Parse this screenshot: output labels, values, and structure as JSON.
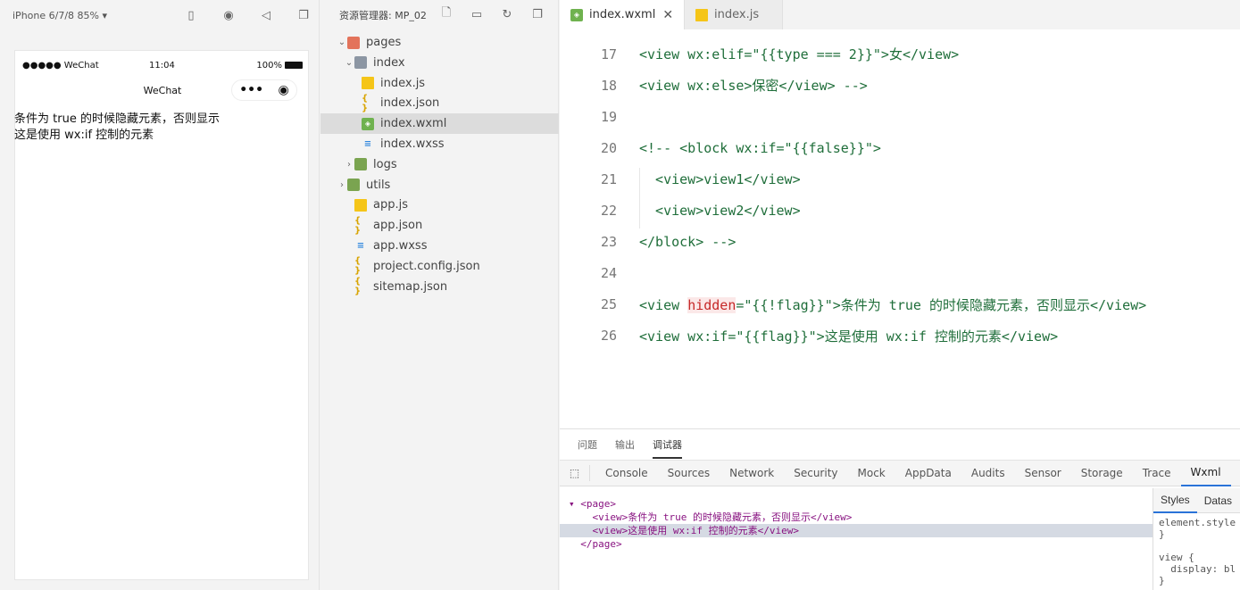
{
  "simulator": {
    "device_label": "iPhone 6/7/8 85% ▾",
    "status_carrier": "●●●●● WeChat",
    "status_time": "11:04",
    "status_battery": "100%",
    "nav_title": "WeChat",
    "capsule_more": "•••",
    "capsule_close": "◉",
    "content_lines": [
      "条件为 true 的时候隐藏元素，否则显示",
      "这是使用 wx:if 控制的元素"
    ]
  },
  "explorer": {
    "title": "资源管理器: MP_02",
    "tree": [
      {
        "label": "pages",
        "icon": "folder-red",
        "chev": "⌄",
        "indent": 0
      },
      {
        "label": "index",
        "icon": "folder-gray",
        "chev": "⌄",
        "indent": 1
      },
      {
        "label": "index.js",
        "icon": "js",
        "chev": "",
        "indent": 2
      },
      {
        "label": "index.json",
        "icon": "json",
        "chev": "",
        "indent": 2
      },
      {
        "label": "index.wxml",
        "icon": "wxml",
        "chev": "",
        "indent": 2,
        "selected": true
      },
      {
        "label": "index.wxss",
        "icon": "wxss",
        "chev": "",
        "indent": 2
      },
      {
        "label": "logs",
        "icon": "folder-green",
        "chev": "›",
        "indent": 1
      },
      {
        "label": "utils",
        "icon": "folder-green",
        "chev": "›",
        "indent": 0
      },
      {
        "label": "app.js",
        "icon": "js",
        "chev": "",
        "indent": 1
      },
      {
        "label": "app.json",
        "icon": "json",
        "chev": "",
        "indent": 1
      },
      {
        "label": "app.wxss",
        "icon": "wxss",
        "chev": "",
        "indent": 1
      },
      {
        "label": "project.config.json",
        "icon": "json",
        "chev": "",
        "indent": 1
      },
      {
        "label": "sitemap.json",
        "icon": "json",
        "chev": "",
        "indent": 1
      }
    ]
  },
  "editor": {
    "tabs": [
      {
        "label": "index.wxml",
        "active": true,
        "close": "✕"
      },
      {
        "label": "index.js",
        "active": false
      }
    ],
    "lines": [
      {
        "num": "17",
        "text": "<view wx:elif=\"{{type === 2}}\">女</view>"
      },
      {
        "num": "18",
        "text": "<view wx:else>保密</view> -->"
      },
      {
        "num": "19",
        "text": ""
      },
      {
        "num": "20",
        "text": "<!-- <block wx:if=\"{{false}}\">"
      },
      {
        "num": "21",
        "text": "  <view>view1</view>"
      },
      {
        "num": "22",
        "text": "  <view>view2</view>"
      },
      {
        "num": "23",
        "text": "</block> -->"
      },
      {
        "num": "24",
        "text": ""
      },
      {
        "num": "25",
        "pre": "<view ",
        "hl": "hidden",
        "post": "=\"{{!flag}}\">条件为 true 的时候隐藏元素，否则显示</view>"
      },
      {
        "num": "26",
        "text": "<view wx:if=\"{{flag}}\">这是使用 wx:if 控制的元素</view>"
      }
    ]
  },
  "bottom": {
    "tabs": [
      "问题",
      "输出",
      "调试器"
    ],
    "devtabs": [
      "Console",
      "Sources",
      "Network",
      "Security",
      "Mock",
      "AppData",
      "Audits",
      "Sensor",
      "Storage",
      "Trace",
      "Wxml"
    ],
    "wxml_lines": [
      "▾ <page>",
      "    <view>条件为 true 的时候隐藏元素，否则显示</view>",
      "    <view>这是使用 wx:if 控制的元素</view>",
      "  </page>"
    ],
    "side_tabs": [
      "Styles",
      "Datas"
    ],
    "side_lines": [
      "element.style",
      "}",
      "",
      "view {",
      "  display: bl",
      "}"
    ]
  }
}
